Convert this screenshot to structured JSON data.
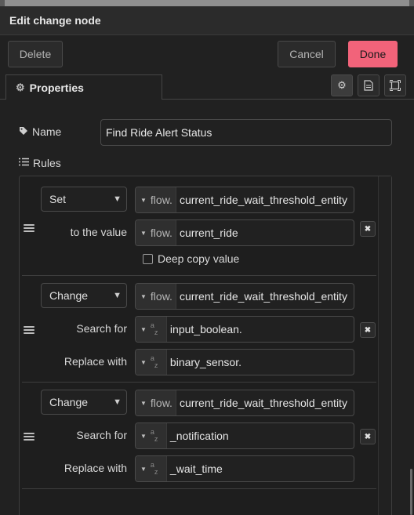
{
  "dialog": {
    "title": "Edit change node",
    "delete_label": "Delete",
    "cancel_label": "Cancel",
    "done_label": "Done"
  },
  "tabs": {
    "properties_label": "Properties"
  },
  "form": {
    "name_label": "Name",
    "name_value": "Find Ride Alert Status",
    "rules_label": "Rules"
  },
  "rules": [
    {
      "action": "Set",
      "target_type": "flow.",
      "target_value": "current_ride_wait_threshold_entity",
      "to_label": "to the value",
      "to_type": "flow.",
      "to_value": "current_ride",
      "deep_copy_label": "Deep copy value"
    },
    {
      "action": "Change",
      "target_type": "flow.",
      "target_value": "current_ride_wait_threshold_entity",
      "search_label": "Search for",
      "search_value": "input_boolean.",
      "replace_label": "Replace with",
      "replace_value": "binary_sensor."
    },
    {
      "action": "Change",
      "target_type": "flow.",
      "target_value": "current_ride_wait_threshold_entity",
      "search_label": "Search for",
      "search_value": "_notification",
      "replace_label": "Replace with",
      "replace_value": "_wait_time"
    }
  ],
  "typed_input_string_marker": {
    "top": "a",
    "bottom": "z"
  },
  "colors": {
    "background": "#212121",
    "done_button": "#f2637a",
    "border": "#4a4a4a"
  }
}
